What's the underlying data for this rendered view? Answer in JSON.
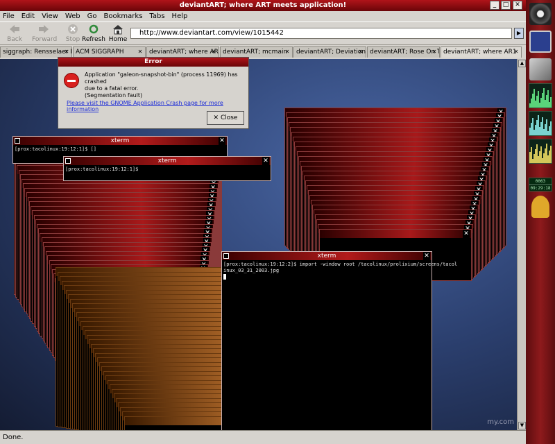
{
  "window": {
    "title": "deviantART; where ART meets application!"
  },
  "menu": {
    "items": [
      {
        "label": "File"
      },
      {
        "label": "Edit"
      },
      {
        "label": "View"
      },
      {
        "label": "Web"
      },
      {
        "label": "Go"
      },
      {
        "label": "Bookmarks"
      },
      {
        "label": "Tabs"
      },
      {
        "label": "Help"
      }
    ]
  },
  "toolbar": {
    "back": "Back",
    "forward": "Forward",
    "stop": "Stop",
    "refresh": "Refresh",
    "home": "Home"
  },
  "location": {
    "url": "http://www.deviantart.com/view/1015442"
  },
  "tabs": [
    {
      "label": "siggraph: Rensselaer P"
    },
    {
      "label": "ACM SIGGRAPH"
    },
    {
      "label": "deviantART; where AR1"
    },
    {
      "label": "deviantART; mcmain"
    },
    {
      "label": "deviantART; Deviation"
    },
    {
      "label": "deviantART; Rose On T"
    },
    {
      "label": "deviantART; where AR1"
    }
  ],
  "status": {
    "text": "Done."
  },
  "watermark": "my.com",
  "xterm": {
    "title": "xterm",
    "prompt_small": "[prox:tacolinux:19:12:1]$ ",
    "prompt_small2": "[prox:tacolinux:19:12:1]$ []",
    "prompt_main": "[prox:tacolinux:19:12:2]$ import -window root /tacolinux/prolixium/screens/tacol",
    "prompt_main2": "inux_03_31_2003.jpg"
  },
  "error_dialog": {
    "title": "Error",
    "message_line1": "Application \"galeon-snapshot-bin\" (process 11969) has crashed",
    "message_line2": "due to a fatal error.",
    "message_line3": "(Segmentation fault)",
    "link": "Please visit the GNOME Application Crash page for more information",
    "close_label": "Close"
  },
  "panel": {
    "uptime": "0063 days",
    "clock": "09:29:18"
  },
  "colors": {
    "title_red": "#b0141a",
    "xterm_title": "#b21b1b",
    "panel": "#8e1a1c"
  }
}
